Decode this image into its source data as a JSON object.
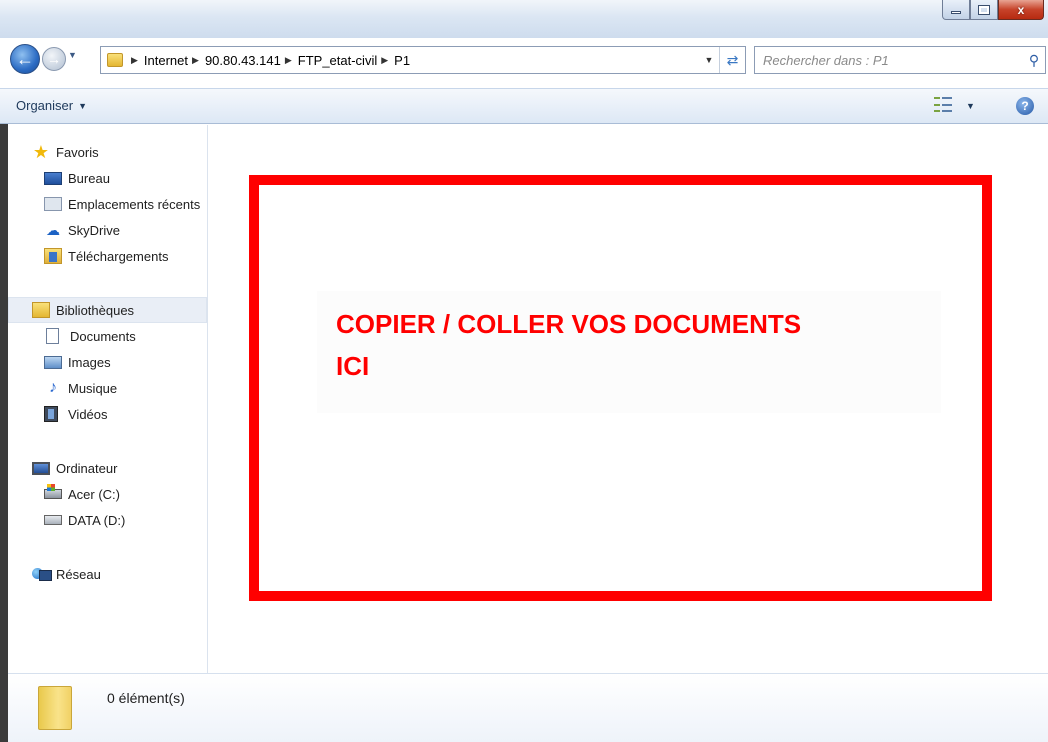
{
  "window": {
    "minimize_label": "",
    "maximize_label": "",
    "close_label": "x"
  },
  "address": {
    "breadcrumbs": [
      "Internet",
      "90.80.43.141",
      "FTP_etat-civil",
      "P1"
    ]
  },
  "search": {
    "placeholder": "Rechercher dans : P1"
  },
  "toolbar": {
    "organize_label": "Organiser"
  },
  "sidebar": {
    "favorites": {
      "label": "Favoris",
      "items": [
        "Bureau",
        "Emplacements récents",
        "SkyDrive",
        "Téléchargements"
      ]
    },
    "libraries": {
      "label": "Bibliothèques",
      "items": [
        "Documents",
        "Images",
        "Musique",
        "Vidéos"
      ]
    },
    "computer": {
      "label": "Ordinateur",
      "items": [
        "Acer (C:)",
        "DATA (D:)"
      ]
    },
    "network": {
      "label": "Réseau"
    }
  },
  "content": {
    "overlay_line1": "COPIER / COLLER VOS DOCUMENTS",
    "overlay_line2": "ICI",
    "overlay_color": "#ff0000"
  },
  "status": {
    "item_count": "0 élément(s)"
  },
  "icons": {
    "back": "back-arrow-icon",
    "forward": "forward-arrow-icon",
    "search": "search-icon",
    "help": "help-icon",
    "views": "views-icon"
  }
}
